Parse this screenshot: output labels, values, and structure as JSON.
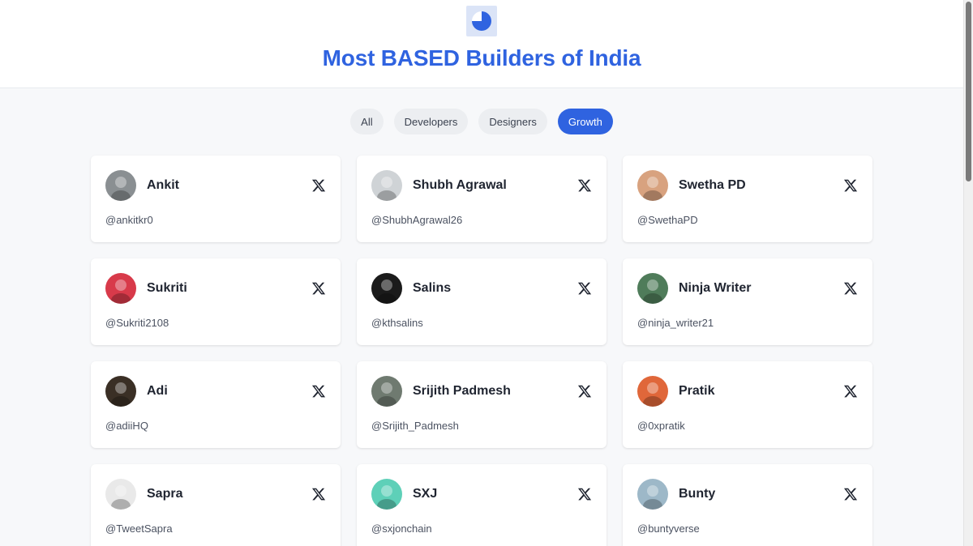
{
  "header": {
    "title": "Most BASED Builders of India",
    "logo_icon": "half-circle-logo"
  },
  "filters": [
    {
      "label": "All",
      "active": false
    },
    {
      "label": "Developers",
      "active": false
    },
    {
      "label": "Designers",
      "active": false
    },
    {
      "label": "Growth",
      "active": true
    }
  ],
  "colors": {
    "accent": "#2f63e0",
    "background": "#f7f8fa",
    "card": "#ffffff"
  },
  "builders": [
    {
      "name": "Ankit",
      "handle": "@ankitkr0",
      "avatar_color": "#8a8f92"
    },
    {
      "name": "Shubh Agrawal",
      "handle": "@ShubhAgrawal26",
      "avatar_color": "#cfd3d6"
    },
    {
      "name": "Swetha PD",
      "handle": "@SwethaPD",
      "avatar_color": "#d8a27f"
    },
    {
      "name": "Sukriti",
      "handle": "@Sukriti2108",
      "avatar_color": "#d83a4a"
    },
    {
      "name": "Salins",
      "handle": "@kthsalins",
      "avatar_color": "#1b1b1b"
    },
    {
      "name": "Ninja Writer",
      "handle": "@ninja_writer21",
      "avatar_color": "#4f7c5a"
    },
    {
      "name": "Adi",
      "handle": "@adiiHQ",
      "avatar_color": "#3a2f25"
    },
    {
      "name": "Srijith Padmesh",
      "handle": "@Srijith_Padmesh",
      "avatar_color": "#6f7a70"
    },
    {
      "name": "Pratik",
      "handle": "@0xpratik",
      "avatar_color": "#e0673a"
    },
    {
      "name": "Sapra",
      "handle": "@TweetSapra",
      "avatar_color": "#e9e9e9"
    },
    {
      "name": "SXJ",
      "handle": "@sxjonchain",
      "avatar_color": "#5ed0b8"
    },
    {
      "name": "Bunty",
      "handle": "@buntyverse",
      "avatar_color": "#9db8c8"
    }
  ],
  "card_icon": "x-logo-icon"
}
